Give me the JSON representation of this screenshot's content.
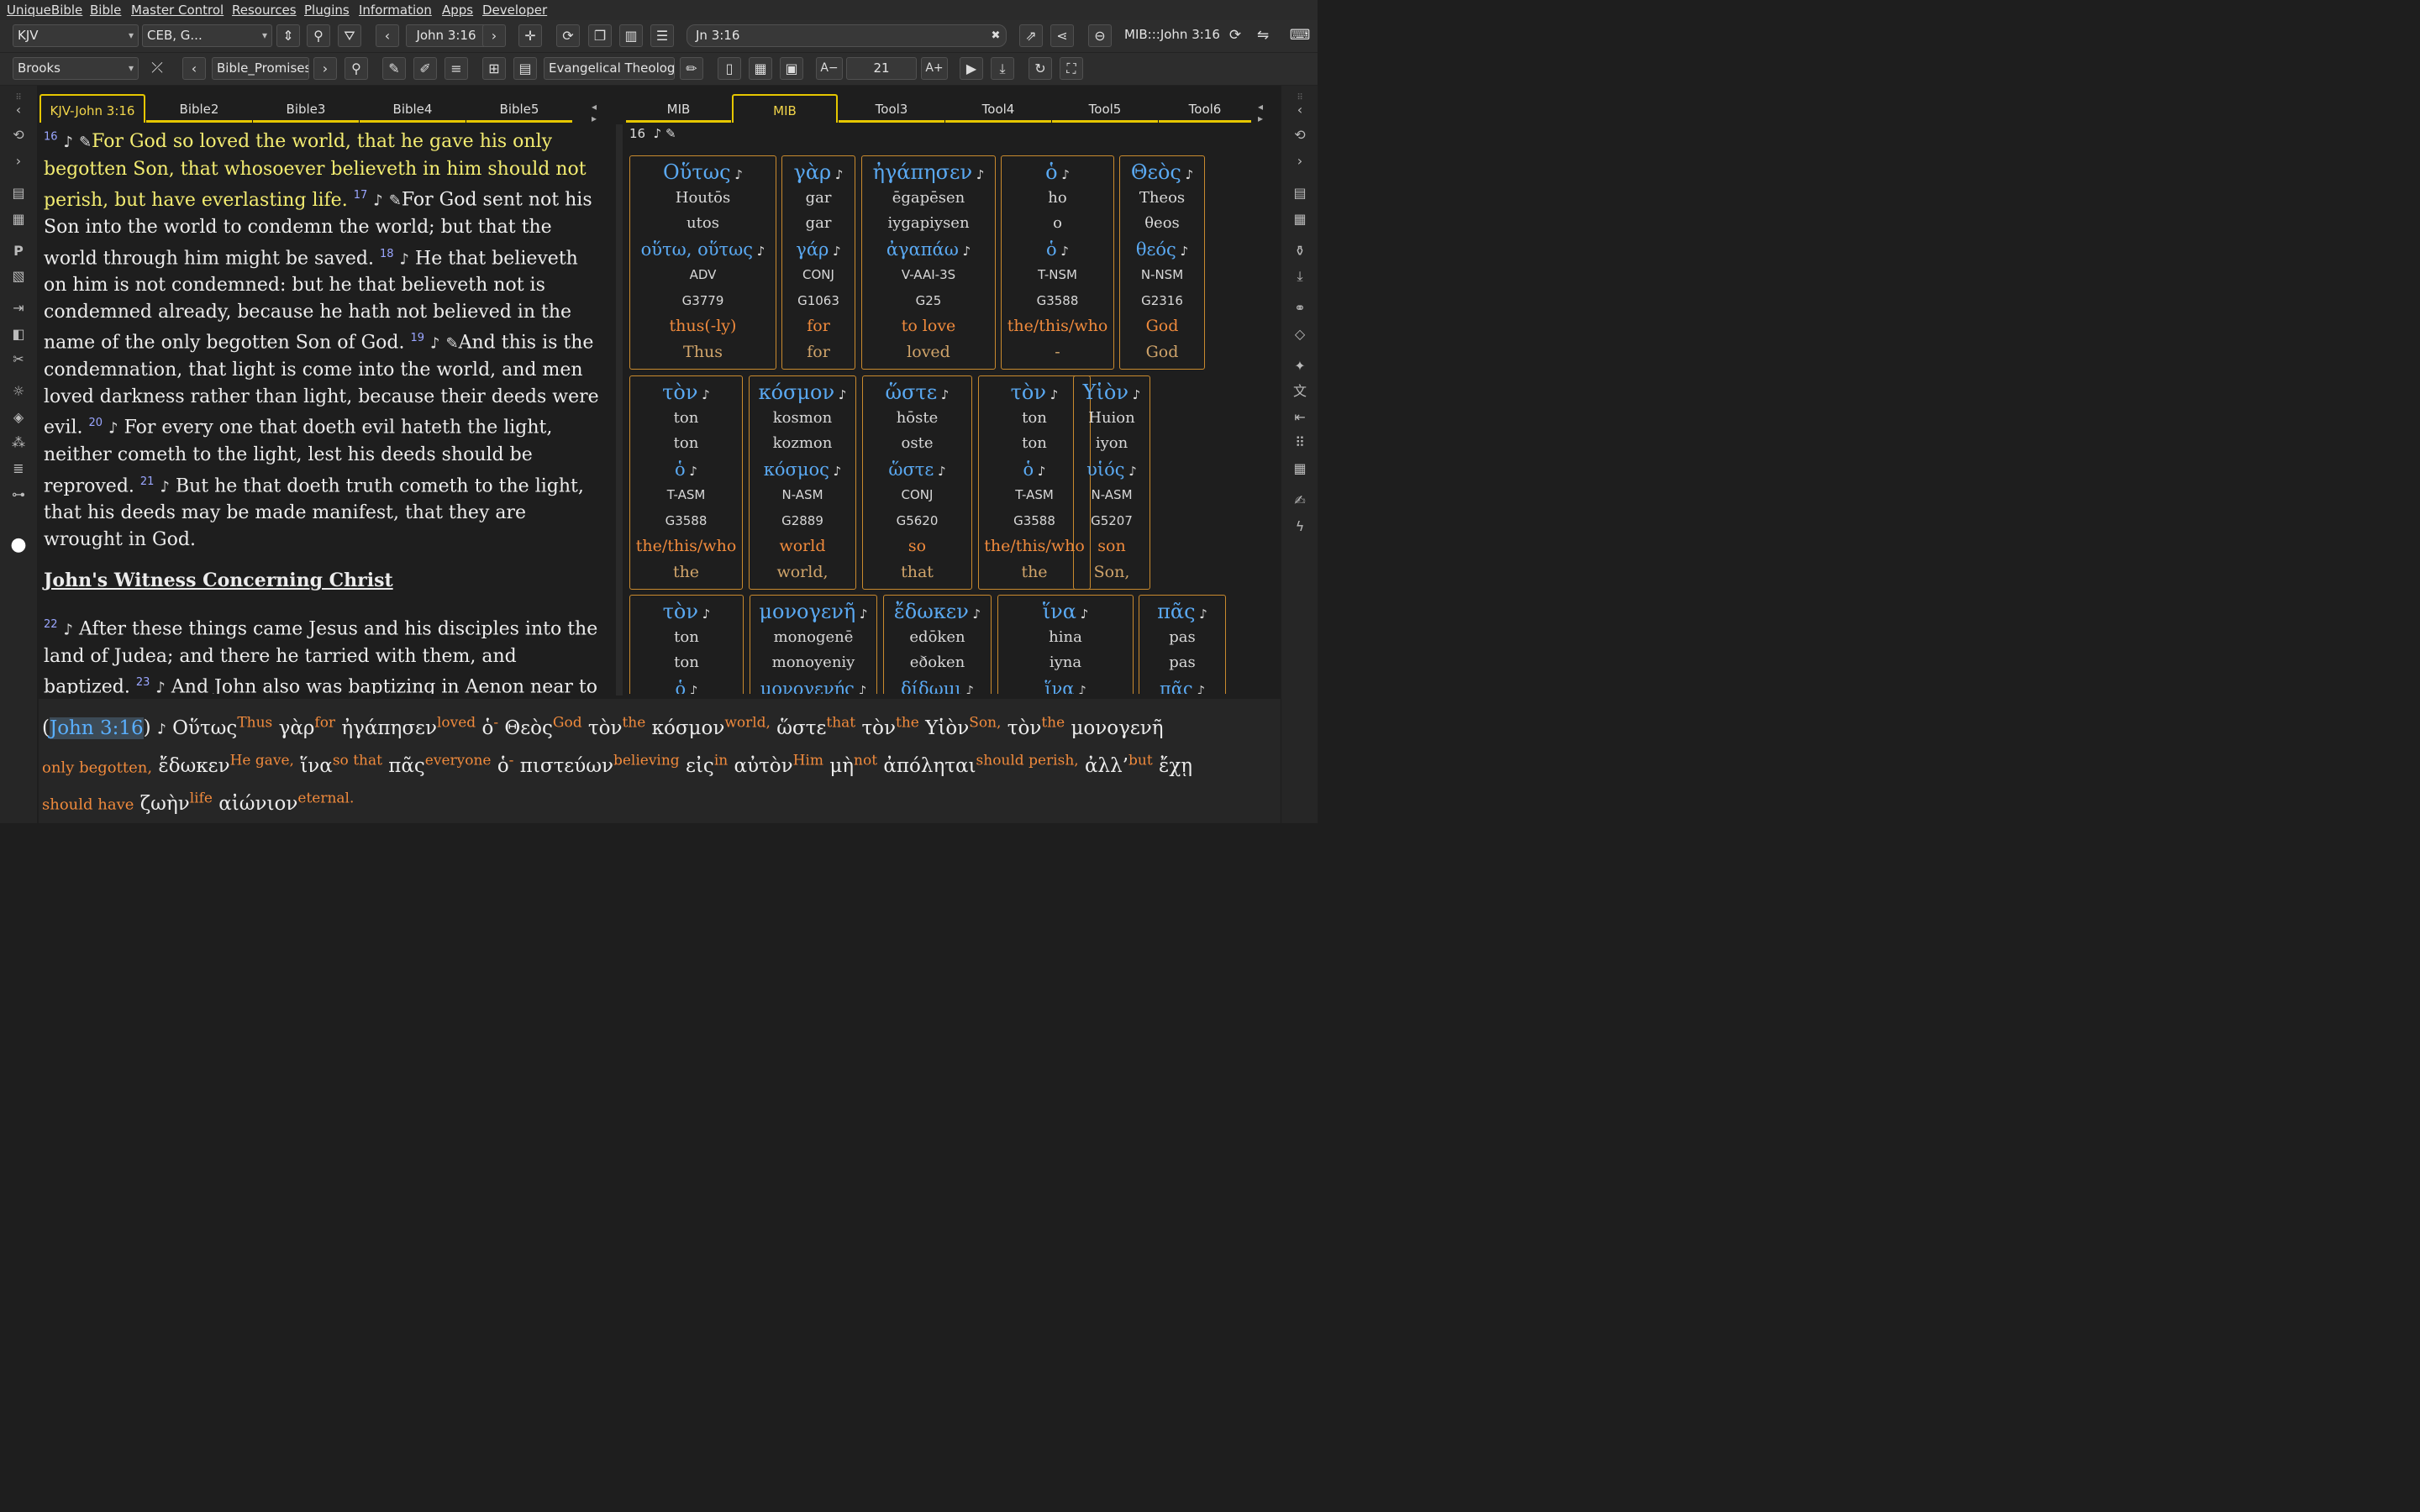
{
  "menu": [
    "UniqueBible",
    "Bible",
    "Master Control",
    "Resources",
    "Plugins",
    "Information",
    "Apps",
    "Developer"
  ],
  "toolbar1": {
    "bible_version": "KJV",
    "parallel_versions": "CEB, G...",
    "reference": "John 3:16",
    "search_value": "Jn 3:16",
    "right_label": "MIB:::John 3:16"
  },
  "toolbar2": {
    "commentary": "Brooks",
    "topic": "Bible_Promises",
    "theology": "Evangelical Theology",
    "font_size": "21"
  },
  "left_tabs": [
    "KJV-John 3:16",
    "Bible2",
    "Bible3",
    "Bible4",
    "Bible5"
  ],
  "right_tabs": [
    "MIB",
    "MIB",
    "Tool3",
    "Tool4",
    "Tool5",
    "Tool6"
  ],
  "bible": {
    "v16_num": "16",
    "v16_text": "For God so loved the world, that he gave his only begotten Son, that whosoever believeth in him should not perish, but have everlasting life.",
    "v17_num": "17",
    "v17_text": "For God sent not his Son into the world to condemn the world; but that the world through him might be saved.",
    "v18_num": "18",
    "v18_text": "He that believeth on him is not condemned: but he that believeth not is condemned already, because he hath not believed in the name of the only begotten Son of God.",
    "v19_num": "19",
    "v19_text": "And this is the condemnation, that light is come into the world, and men loved darkness rather than light, because their deeds were evil.",
    "v20_num": "20",
    "v20_text": "For every one that doeth evil hateth the light, neither cometh to the light, lest his deeds should be reproved.",
    "v21_num": "21",
    "v21_text": "But he that doeth truth cometh to the light, that his deeds may be made manifest, that they are wrought in God.",
    "heading": "John's Witness Concerning Christ",
    "v22_num": "22",
    "v22_text": "After these things came Jesus and his disciples into the land of Judea; and there he tarried with them, and baptized.",
    "v23_num": "23",
    "v23_text": "And John also was baptizing in Aenon near to Salim, because there was much water there: and they came, and"
  },
  "interlinear_verse": "16",
  "cards": [
    {
      "g": "Οὕτως",
      "t1": "Houtōs",
      "t2": "utos",
      "lex": "οὕτω, οὕτως",
      "m": "ADV",
      "s": "G3779",
      "gl": "thus(-ly)",
      "en": "Thus"
    },
    {
      "g": "γὰρ",
      "t1": "gar",
      "t2": "gar",
      "lex": "γάρ",
      "m": "CONJ",
      "s": "G1063",
      "gl": "for",
      "en": "for"
    },
    {
      "g": "ἠγάπησεν",
      "t1": "ēgapēsen",
      "t2": "iygapiysen",
      "lex": "ἀγαπάω",
      "m": "V-AAI-3S",
      "s": "G25",
      "gl": "to love",
      "en": "loved"
    },
    {
      "g": "ὁ",
      "t1": "ho",
      "t2": "o",
      "lex": "ὁ",
      "m": "T-NSM",
      "s": "G3588",
      "gl": "the/this/who",
      "en": "-"
    },
    {
      "g": "Θεὸς",
      "t1": "Theos",
      "t2": "θeos",
      "lex": "θεός",
      "m": "N-NSM",
      "s": "G2316",
      "gl": "God",
      "en": "God"
    },
    {
      "g": "τὸν",
      "t1": "ton",
      "t2": "ton",
      "lex": "ὁ",
      "m": "T-ASM",
      "s": "G3588",
      "gl": "the/this/who",
      "en": "the"
    },
    {
      "g": "κόσμον",
      "t1": "kosmon",
      "t2": "kozmon",
      "lex": "κόσμος",
      "m": "N-ASM",
      "s": "G2889",
      "gl": "world",
      "en": "world,"
    },
    {
      "g": "ὥστε",
      "t1": "hōste",
      "t2": "oste",
      "lex": "ὥστε",
      "m": "CONJ",
      "s": "G5620",
      "gl": "so",
      "en": "that"
    },
    {
      "g": "τὸν",
      "t1": "ton",
      "t2": "ton",
      "lex": "ὁ",
      "m": "T-ASM",
      "s": "G3588",
      "gl": "the/this/who",
      "en": "the"
    },
    {
      "g": "Υἱὸν",
      "t1": "Huion",
      "t2": "iyon",
      "lex": "υἱός",
      "m": "N-ASM",
      "s": "G5207",
      "gl": "son",
      "en": "Son,"
    },
    {
      "g": "τὸν",
      "t1": "ton",
      "t2": "ton",
      "lex": "ὁ",
      "m": "",
      "s": "",
      "gl": "",
      "en": ""
    },
    {
      "g": "μονογενῆ",
      "t1": "monogenē",
      "t2": "monoyeniy",
      "lex": "μονογενής",
      "m": "",
      "s": "",
      "gl": "",
      "en": ""
    },
    {
      "g": "ἔδωκεν",
      "t1": "edōken",
      "t2": "eðoken",
      "lex": "δίδωμι",
      "m": "",
      "s": "",
      "gl": "",
      "en": ""
    },
    {
      "g": "ἵνα",
      "t1": "hina",
      "t2": "iyna",
      "lex": "ἵνα",
      "m": "",
      "s": "",
      "gl": "",
      "en": ""
    },
    {
      "g": "πᾶς",
      "t1": "pas",
      "t2": "pas",
      "lex": "πᾶς",
      "m": "",
      "s": "",
      "gl": "",
      "en": ""
    }
  ],
  "bottom": {
    "ref": "John 3:16",
    "words": [
      {
        "g": "Οὕτως",
        "e": "Thus"
      },
      {
        "g": "γὰρ",
        "e": "for"
      },
      {
        "g": "ἠγάπησεν",
        "e": "loved"
      },
      {
        "g": "ὁ",
        "e": "-"
      },
      {
        "g": "Θεὸς",
        "e": "God"
      },
      {
        "g": "τὸν",
        "e": "the"
      },
      {
        "g": "κόσμον",
        "e": "world,"
      },
      {
        "g": "ὥστε",
        "e": "that"
      },
      {
        "g": "τὸν",
        "e": "the"
      },
      {
        "g": "Υἱὸν",
        "e": "Son,"
      },
      {
        "g": "τὸν",
        "e": "the"
      },
      {
        "g": "μονογενῆ",
        "e": ""
      }
    ],
    "line2_lead": "only begotten,",
    "words2": [
      {
        "g": "ἔδωκεν",
        "e": "He gave,"
      },
      {
        "g": "ἵνα",
        "e": "so that"
      },
      {
        "g": "πᾶς",
        "e": "everyone"
      },
      {
        "g": "ὁ",
        "e": "-"
      },
      {
        "g": "πιστεύων",
        "e": "believing"
      },
      {
        "g": "εἰς",
        "e": "in"
      },
      {
        "g": "αὐτὸν",
        "e": "Him"
      },
      {
        "g": "μὴ",
        "e": "not"
      },
      {
        "g": "ἀπόληται",
        "e": "should perish,"
      },
      {
        "g": "ἀλλ’",
        "e": "but"
      },
      {
        "g": "ἔχῃ",
        "e": ""
      }
    ],
    "line3_lead": "should have",
    "words3": [
      {
        "g": "ζωὴν",
        "e": "life"
      },
      {
        "g": "αἰώνιον",
        "e": "eternal."
      }
    ]
  }
}
